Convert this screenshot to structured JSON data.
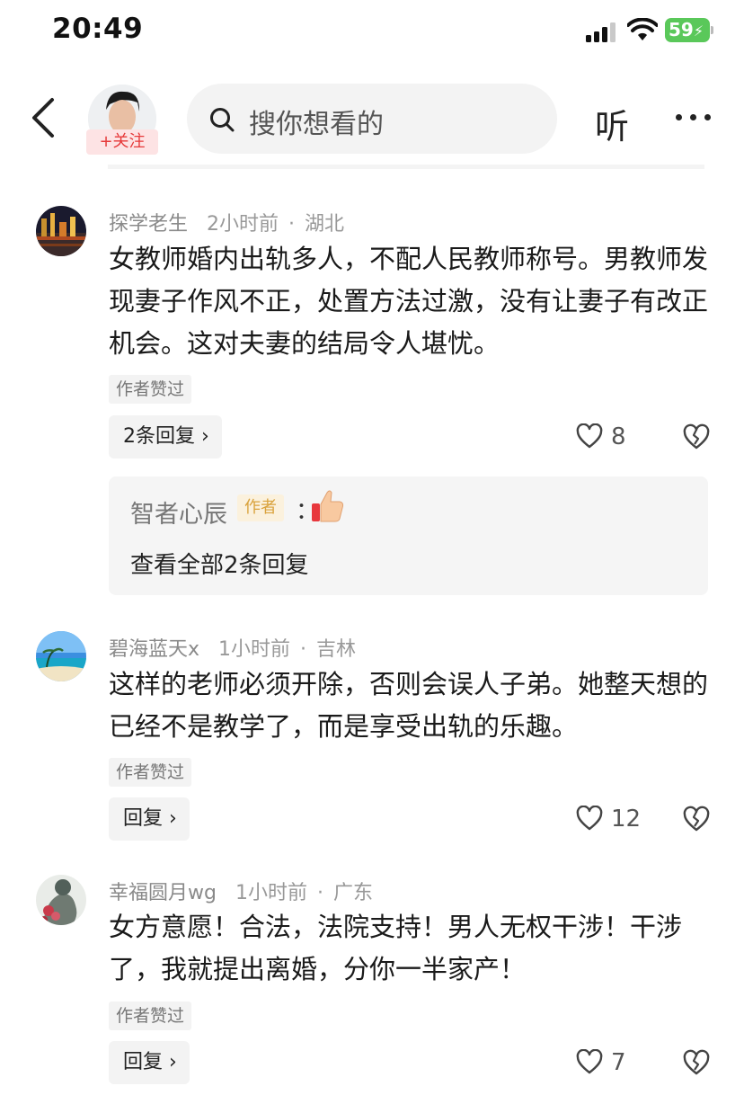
{
  "status_bar": {
    "time": "20:49",
    "battery": "59"
  },
  "nav": {
    "follow_label": "+关注",
    "search_placeholder": "搜你想看的",
    "listen_label": "听"
  },
  "comments": [
    {
      "username": "探学老生",
      "time": "2小时前",
      "separator": "·",
      "location": "湖北",
      "text": "女教师婚内出轨多人，不配人民教师称号。男教师发现妻子作风不正，处置方法过激，没有让妻子有改正机会。这对夫妻的结局令人堪忧。",
      "author_liked": "作者赞过",
      "reply_label": "2条回复 ›",
      "likes": "8",
      "reply_preview": {
        "username": "智者心辰",
        "tag": "作者",
        "colon": "：",
        "view_all": "查看全部2条回复"
      }
    },
    {
      "username": "碧海蓝天x",
      "time": "1小时前",
      "separator": "·",
      "location": "吉林",
      "text": "这样的老师必须开除，否则会误人子弟。她整天想的已经不是教学了，而是享受出轨的乐趣。",
      "author_liked": "作者赞过",
      "reply_label": "回复 ›",
      "likes": "12"
    },
    {
      "username": "幸福圆月wg",
      "time": "1小时前",
      "separator": "·",
      "location": "广东",
      "text": "女方意愿！合法，法院支持！男人无权干涉！干涉了，我就提出离婚，分你一半家产！",
      "author_liked": "作者赞过",
      "reply_label": "回复 ›",
      "likes": "7"
    }
  ]
}
